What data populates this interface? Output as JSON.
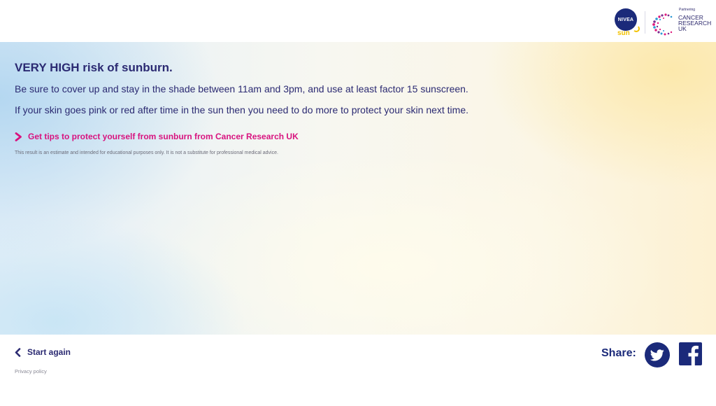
{
  "header": {
    "nivea_logo": {
      "brand": "NIVEA",
      "sub": "sun"
    },
    "partner_logo": {
      "partnering": "Partnering",
      "line1": "CANCER",
      "line2": "RESEARCH",
      "line3": "UK"
    }
  },
  "result": {
    "headline": "VERY HIGH risk of sunburn.",
    "paragraph1": "Be sure to cover up and stay in the shade between 11am and 3pm, and use at least factor 15 sunscreen.",
    "paragraph2": "If your skin goes pink or red after time in the sun then you need to do more to protect your skin next time.",
    "tips_link": "Get tips to protect yourself from sunburn from Cancer Research UK",
    "disclaimer": "This result is an estimate and intended for educational purposes only. It is not a substitute for professional medical advice."
  },
  "footer": {
    "start_again": "Start again",
    "privacy_policy": "Privacy policy",
    "share_label": "Share:",
    "share_icons": [
      "twitter-icon",
      "facebook-icon"
    ]
  },
  "colors": {
    "navy": "#2b2a72",
    "brand_blue": "#1b2a7a",
    "link_pink": "#d8137f",
    "sun_yellow": "#f2c200"
  }
}
